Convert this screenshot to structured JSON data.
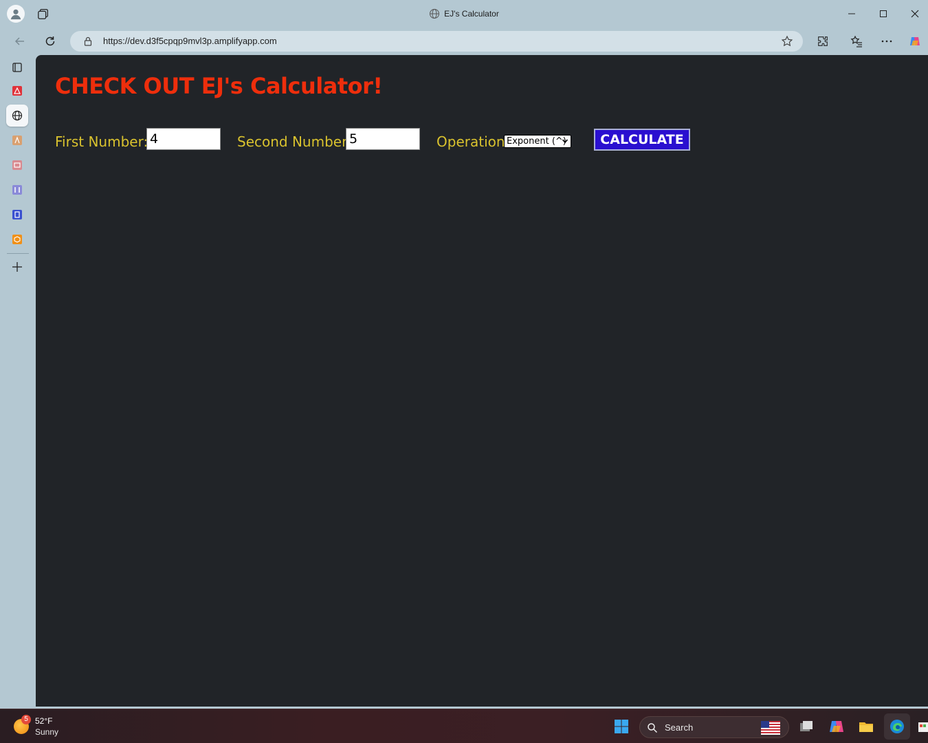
{
  "window": {
    "title": "EJ's Calculator"
  },
  "address_bar": {
    "url": "https://dev.d3f5cpqp9mvl3p.amplifyapp.com"
  },
  "sidebar": {
    "items": [
      {
        "icon": "tab-actions-icon"
      },
      {
        "icon": "red-app-icon"
      },
      {
        "icon": "globe-icon"
      },
      {
        "icon": "orange-app-icon"
      },
      {
        "icon": "pink-app-icon"
      },
      {
        "icon": "purple-app-icon"
      },
      {
        "icon": "blue-app-icon"
      },
      {
        "icon": "box-app-icon"
      },
      {
        "icon": "add-icon"
      }
    ]
  },
  "page": {
    "heading": "CHECK OUT EJ's Calculator!",
    "first_label": "First Number:",
    "first_value": "4",
    "second_label": "Second Number",
    "second_value": "5",
    "operation_label": "Operation:",
    "operation_selected": "Exponent (^)",
    "calculate_label": "CALCULATE",
    "colors": {
      "background": "#212428",
      "heading": "#ee2e0c",
      "label": "#d9c22e",
      "button": "#2a10d0"
    }
  },
  "taskbar": {
    "weather_badge": "5",
    "temperature": "52°F",
    "condition": "Sunny",
    "search_label": "Search"
  }
}
